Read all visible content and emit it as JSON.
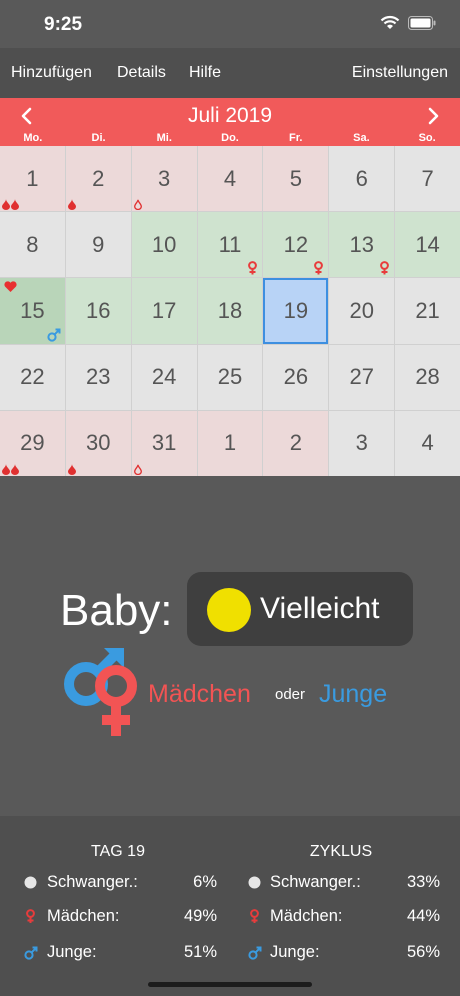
{
  "status_bar": {
    "time": "9:25"
  },
  "toolbar": {
    "add_label": "Hinzufügen",
    "details_label": "Details",
    "help_label": "Hilfe",
    "settings_label": "Einstellungen"
  },
  "calendar": {
    "month_title": "Juli 2019",
    "weekdays": [
      "Mo.",
      "Di.",
      "Mi.",
      "Do.",
      "Fr.",
      "Sa.",
      "So."
    ],
    "rows": [
      [
        "1",
        "2",
        "3",
        "4",
        "5",
        "6",
        "7"
      ],
      [
        "8",
        "9",
        "10",
        "11",
        "12",
        "13",
        "14"
      ],
      [
        "15",
        "16",
        "17",
        "18",
        "19",
        "20",
        "21"
      ],
      [
        "22",
        "23",
        "24",
        "25",
        "26",
        "27",
        "28"
      ],
      [
        "29",
        "30",
        "31",
        "1",
        "2",
        "3",
        "4"
      ]
    ]
  },
  "baby": {
    "label": "Baby:",
    "status": "Vielleicht",
    "girl": "Mädchen",
    "or": "oder",
    "boy": "Junge"
  },
  "stats": {
    "day": {
      "title": "TAG 19",
      "pregnant_label": "Schwanger.:",
      "pregnant_value": "6%",
      "girl_label": "Mädchen:",
      "girl_value": "49%",
      "boy_label": "Junge:",
      "boy_value": "51%"
    },
    "cycle": {
      "title": "ZYKLUS",
      "pregnant_label": "Schwanger.:",
      "pregnant_value": "33%",
      "girl_label": "Mädchen:",
      "girl_value": "44%",
      "boy_label": "Junge:",
      "boy_value": "56%"
    }
  },
  "colors": {
    "period": "#ecd9d9",
    "fertile": "#cfe3cf",
    "today": "#b8d3f6",
    "accent_red": "#f15a5a",
    "boy_blue": "#3a9be0",
    "maybe_yellow": "#f0e000"
  }
}
